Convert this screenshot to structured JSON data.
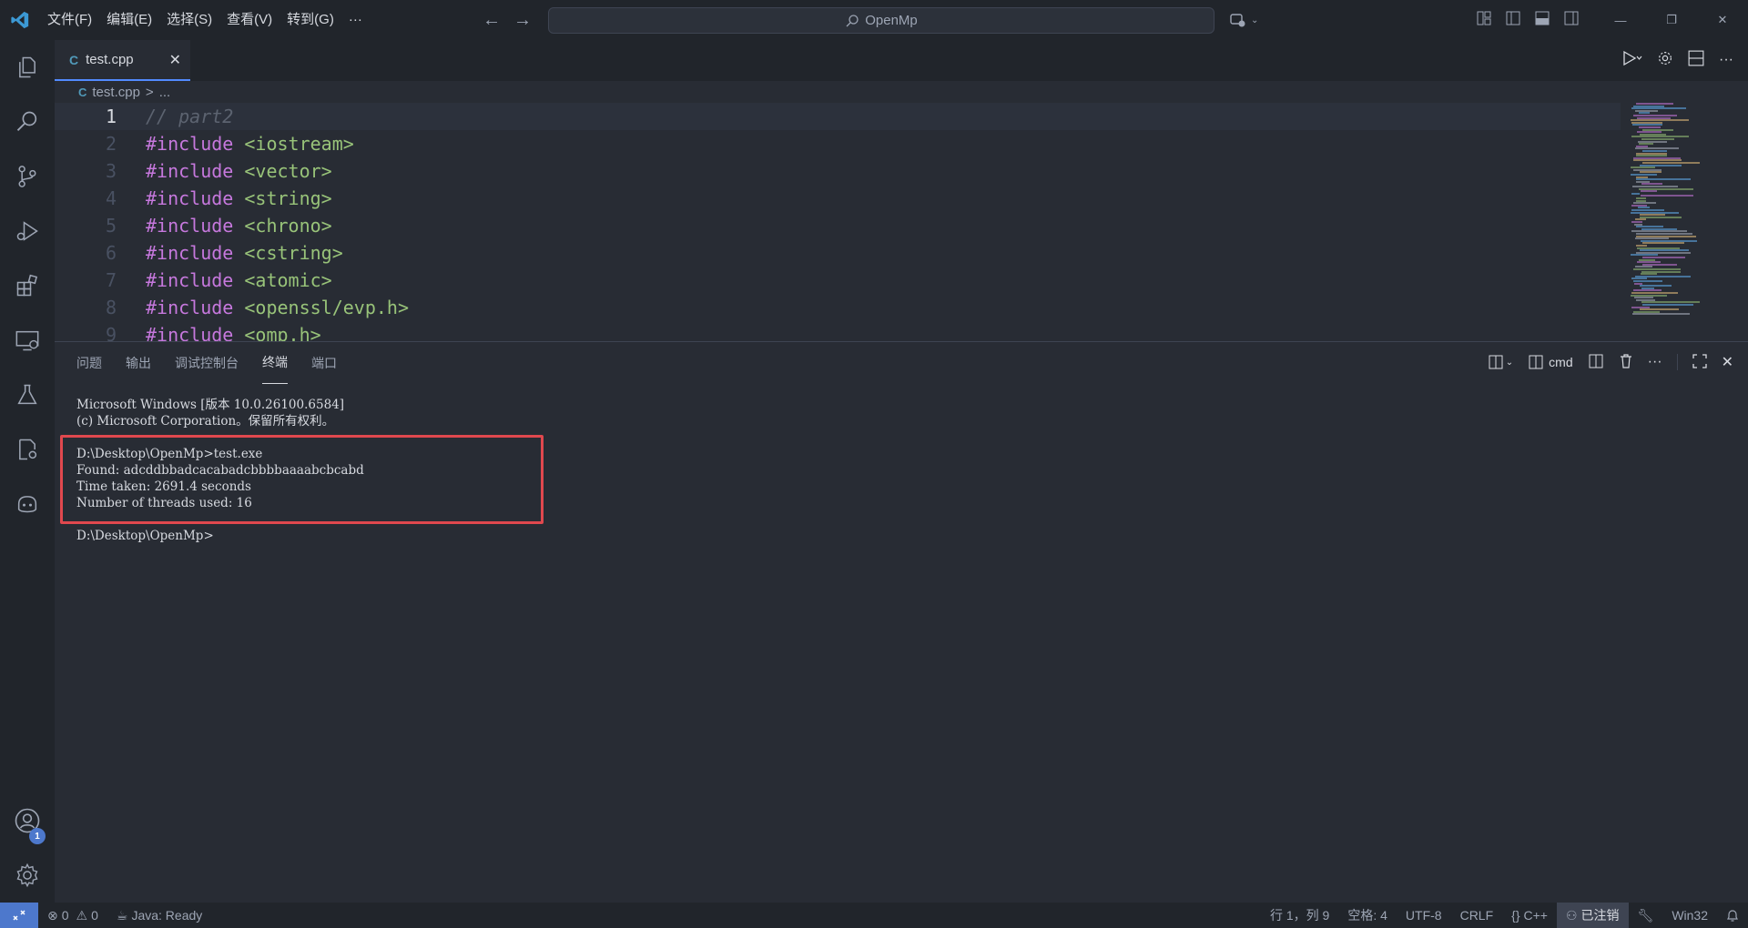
{
  "titlebar": {
    "menu": [
      "文件(F)",
      "编辑(E)",
      "选择(S)",
      "查看(V)",
      "转到(G)",
      "···"
    ],
    "search_text": "OpenMp"
  },
  "tabs": [
    {
      "label": "test.cpp",
      "icon": "C"
    }
  ],
  "breadcrumb": {
    "file": "test.cpp",
    "sep": ">",
    "more": "..."
  },
  "editor": {
    "current_line": 1,
    "lines": [
      {
        "n": "1",
        "parts": [
          {
            "t": "cm",
            "v": "// part2"
          }
        ]
      },
      {
        "n": "2",
        "parts": [
          {
            "t": "kw",
            "v": "#include "
          },
          {
            "t": "str",
            "v": "<iostream>"
          }
        ]
      },
      {
        "n": "3",
        "parts": [
          {
            "t": "kw",
            "v": "#include "
          },
          {
            "t": "str",
            "v": "<vector>"
          }
        ]
      },
      {
        "n": "4",
        "parts": [
          {
            "t": "kw",
            "v": "#include "
          },
          {
            "t": "str",
            "v": "<string>"
          }
        ]
      },
      {
        "n": "5",
        "parts": [
          {
            "t": "kw",
            "v": "#include "
          },
          {
            "t": "str",
            "v": "<chrono>"
          }
        ]
      },
      {
        "n": "6",
        "parts": [
          {
            "t": "kw",
            "v": "#include "
          },
          {
            "t": "str",
            "v": "<cstring>"
          }
        ]
      },
      {
        "n": "7",
        "parts": [
          {
            "t": "kw",
            "v": "#include "
          },
          {
            "t": "str",
            "v": "<atomic>"
          }
        ]
      },
      {
        "n": "8",
        "parts": [
          {
            "t": "kw",
            "v": "#include "
          },
          {
            "t": "str",
            "v": "<openssl/evp.h>"
          }
        ]
      },
      {
        "n": "9",
        "parts": [
          {
            "t": "kw",
            "v": "#include "
          },
          {
            "t": "str",
            "v": "<omp.h>"
          }
        ]
      }
    ]
  },
  "panel": {
    "tabs": [
      "问题",
      "输出",
      "调试控制台",
      "终端",
      "端口"
    ],
    "active_tab": "终端",
    "shell": "cmd",
    "terminal": [
      "Microsoft Windows [版本 10.0.26100.6584]",
      "(c) Microsoft Corporation。保留所有权利。",
      "",
      "D:\\Desktop\\OpenMp>test.exe",
      "Found: adcddbbadcacabadcbbbbaaaabcbcabd",
      "Time taken: 2691.4 seconds",
      "Number of threads used: 16",
      "",
      "D:\\Desktop\\OpenMp>"
    ]
  },
  "activity": {
    "accounts_badge": "1"
  },
  "statusbar": {
    "errors": "0",
    "warnings": "0",
    "java": "Java: Ready",
    "position": "行 1，列 9",
    "spaces": "空格: 4",
    "encoding": "UTF-8",
    "eol": "CRLF",
    "language": "C++",
    "signed_out": "已注销",
    "platform": "Win32"
  },
  "colors": {
    "accent": "#4d78cc",
    "highlight_box": "#e0484e",
    "keyword": "#c678dd",
    "string": "#98c379"
  }
}
